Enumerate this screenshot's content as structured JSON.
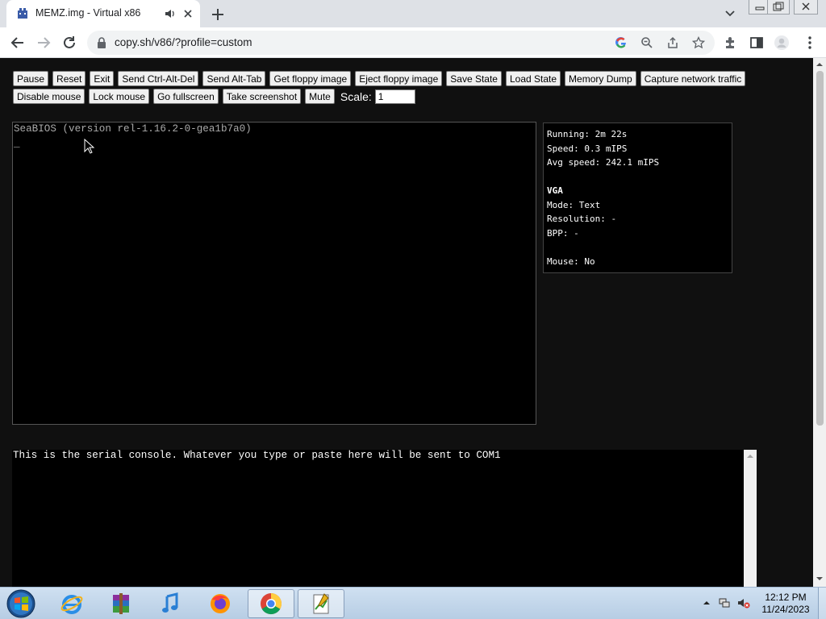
{
  "browser": {
    "tab_title": "MEMZ.img - Virtual x86",
    "url": "copy.sh/v86/?profile=custom"
  },
  "controls": {
    "row1": [
      "Pause",
      "Reset",
      "Exit",
      "Send Ctrl-Alt-Del",
      "Send Alt-Tab",
      "Get floppy image",
      "Eject floppy image",
      "Save State",
      "Load State",
      "Memory Dump",
      "Capture network traffic"
    ],
    "row2": [
      "Disable mouse",
      "Lock mouse",
      "Go fullscreen",
      "Take screenshot",
      "Mute"
    ],
    "scale_label": "Scale:",
    "scale_value": "1"
  },
  "screen": {
    "bios_line": "SeaBIOS (version rel-1.16.2-0-gea1b7a0)",
    "cursor": "_"
  },
  "info": {
    "running": "Running: 2m 22s",
    "speed": "Speed: 0.3 mIPS",
    "avg_speed": "Avg speed: 242.1 mIPS",
    "vga_heading": "VGA",
    "mode": "Mode: Text",
    "resolution": "Resolution: -",
    "bpp": "BPP: -",
    "mouse": "Mouse: No"
  },
  "serial": {
    "text": "This is the serial console. Whatever you type or paste here will be sent to COM1"
  },
  "taskbar": {
    "apps": [
      "start-orb",
      "internet-explorer",
      "winrar",
      "itunes",
      "firefox",
      "chrome",
      "notepad-chart"
    ],
    "clock_time": "12:12 PM",
    "clock_date": "11/24/2023"
  },
  "colors": {
    "page_bg": "#101010",
    "chrome_tabbar": "#dee1e6",
    "taskbar": "#b7cde4"
  }
}
